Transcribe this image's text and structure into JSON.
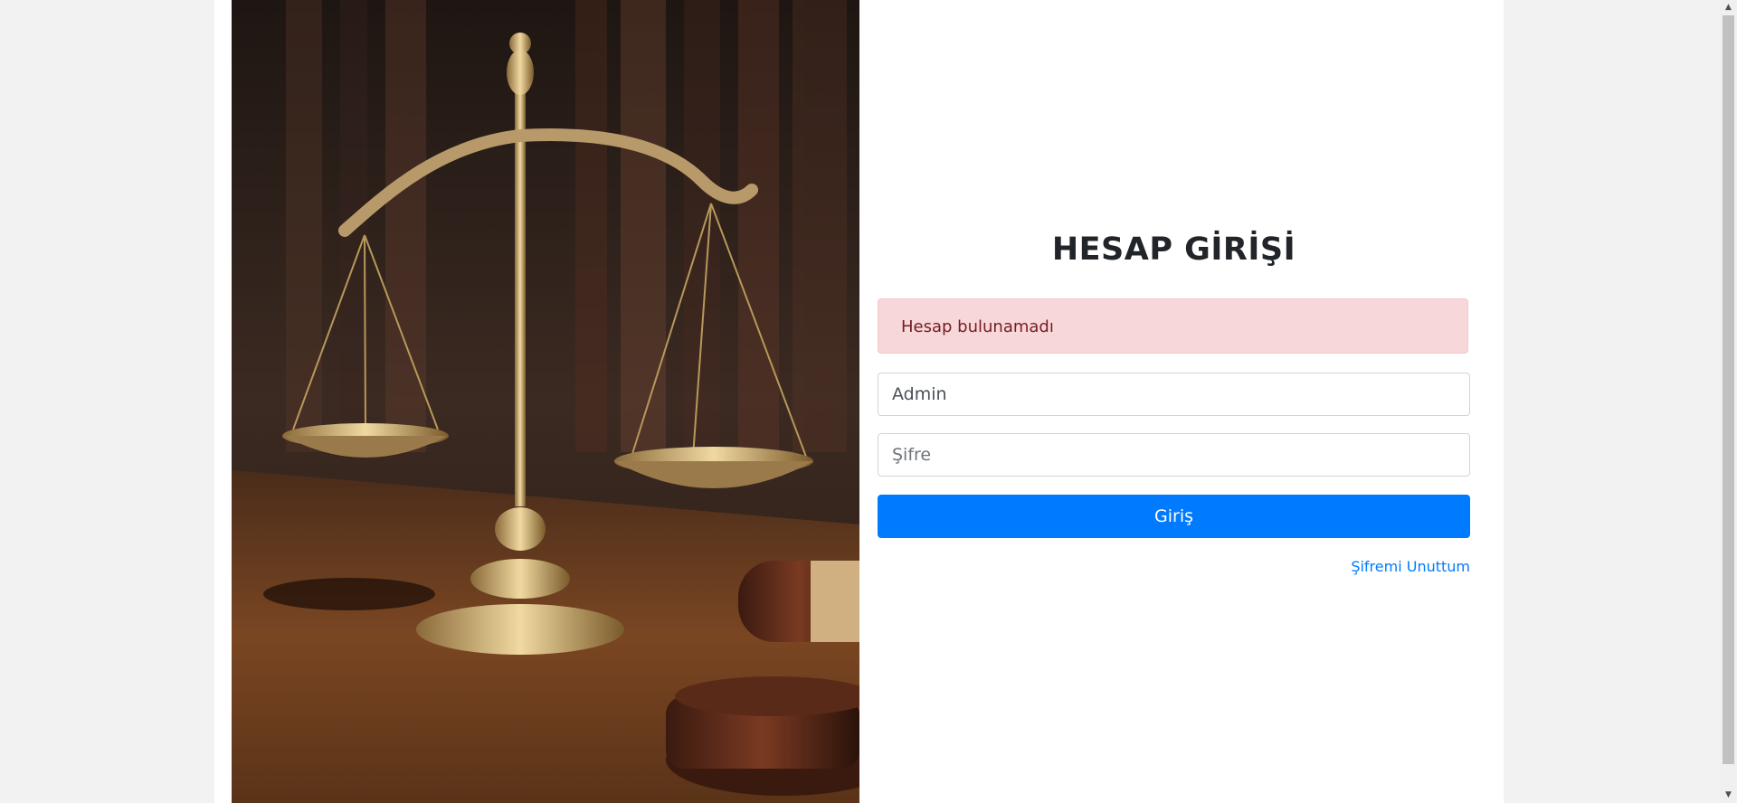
{
  "login": {
    "title": "HESAP GİRİŞİ",
    "alert_message": "Hesap bulunamadı",
    "username_value": "Admin",
    "password_placeholder": "Şifre",
    "submit_label": "Giriş",
    "forgot_link": "Şifremi Unuttum"
  },
  "colors": {
    "primary": "#007bff",
    "alert_bg": "#f8d7da",
    "alert_text": "#721c24",
    "page_bg": "#f2f2f2"
  },
  "icons": {
    "scroll_up": "triangle-up",
    "scroll_down": "triangle-down"
  }
}
